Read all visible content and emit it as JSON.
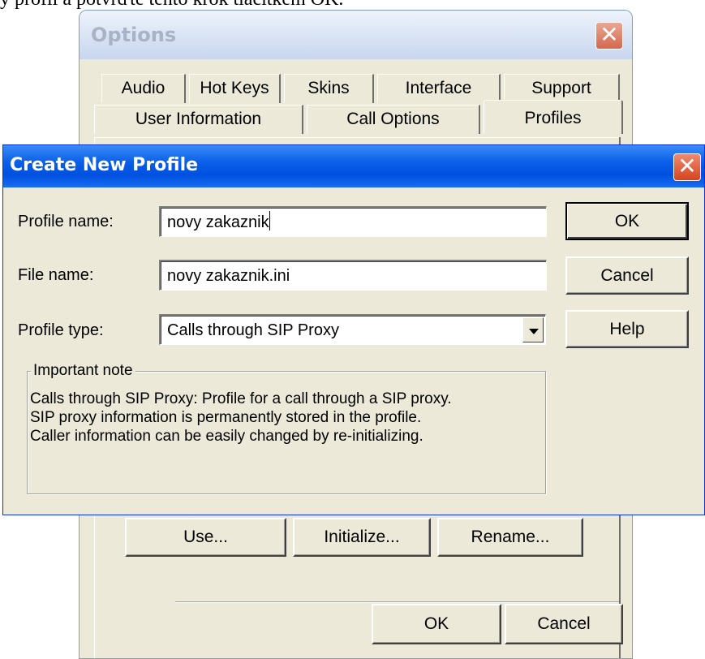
{
  "background_text": "y profil a potvrďte tento krok tlačítkem OK.",
  "options_window": {
    "title": "Options",
    "tabs_back": [
      "Audio",
      "Hot Keys",
      "Skins",
      "Interface",
      "Support"
    ],
    "tabs_front": [
      "User Information",
      "Call Options",
      "Profiles"
    ],
    "active_tab": "Profiles",
    "buttons": {
      "use": "Use...",
      "initialize": "Initialize...",
      "rename": "Rename...",
      "ok": "OK",
      "cancel": "Cancel"
    }
  },
  "dialog": {
    "title": "Create New Profile",
    "profile_name_label": "Profile name:",
    "profile_name_value": "novy zakaznik",
    "file_name_label": "File name:",
    "file_name_value": "novy zakaznik.ini",
    "profile_type_label": "Profile type:",
    "profile_type_value": "Calls through SIP Proxy",
    "buttons": {
      "ok": "OK",
      "cancel": "Cancel",
      "help": "Help"
    },
    "note_title": "Important note",
    "note_lines": [
      "Calls through SIP Proxy: Profile for a call through a SIP proxy.",
      "SIP proxy information is permanently stored in the profile.",
      "Caller information can be easily changed by re-initializing."
    ]
  },
  "colors": {
    "dialog_face": "#ece9d8",
    "title_blue": "#0050e0",
    "close_red": "#d6441e"
  }
}
